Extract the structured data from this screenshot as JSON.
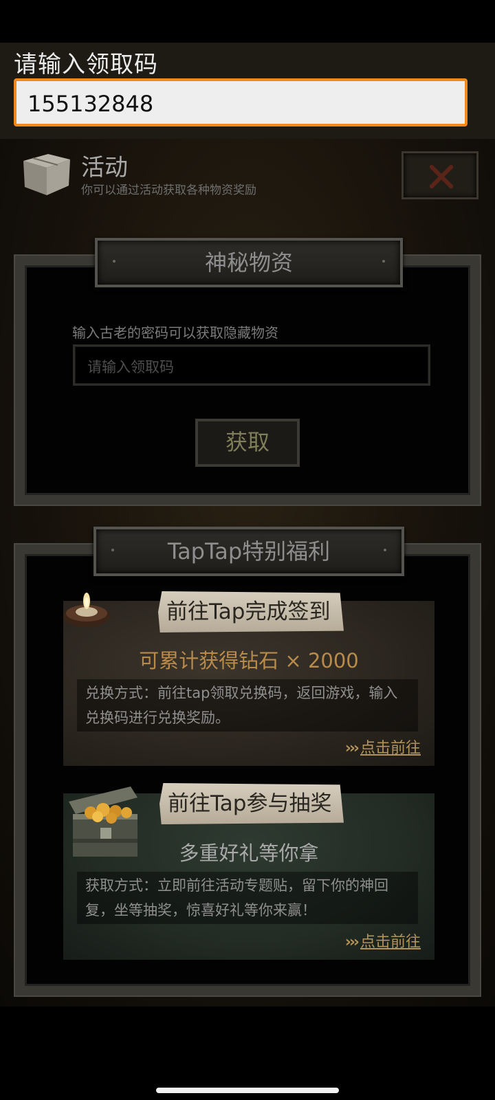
{
  "ime": {
    "prompt": "请输入领取码",
    "input_value": "155132848"
  },
  "activity": {
    "title": "活动",
    "subtitle": "你可以通过活动获取各种物资奖励",
    "close_icon": "close-icon"
  },
  "mystery": {
    "title": "神秘物资",
    "hint": "输入古老的密码可以获取隐藏物资",
    "placeholder": "请输入领取码",
    "button_label": "获取"
  },
  "tap": {
    "title": "TapTap特别福利",
    "cards": [
      {
        "tag": "前往Tap完成签到",
        "headline": "可累计获得钻石 × 2000",
        "description": "兑换方式：前往tap领取兑换码，返回游戏，输入兑换码进行兑换奖励。",
        "link_arrows": "›››",
        "link_label": "点击前往",
        "icon": "candle-icon"
      },
      {
        "tag": "前往Tap参与抽奖",
        "headline": "多重好礼等你拿",
        "description": "获取方式：立即前往活动专题贴，留下你的神回复，坐等抽奖，惊喜好礼等你来赢！",
        "link_arrows": "›››",
        "link_label": "点击前往",
        "icon": "treasure-chest-icon"
      }
    ]
  },
  "colors": {
    "accent_orange": "#f08a1c",
    "gold_text": "#b98b4b",
    "link_gold": "#b3935a"
  }
}
